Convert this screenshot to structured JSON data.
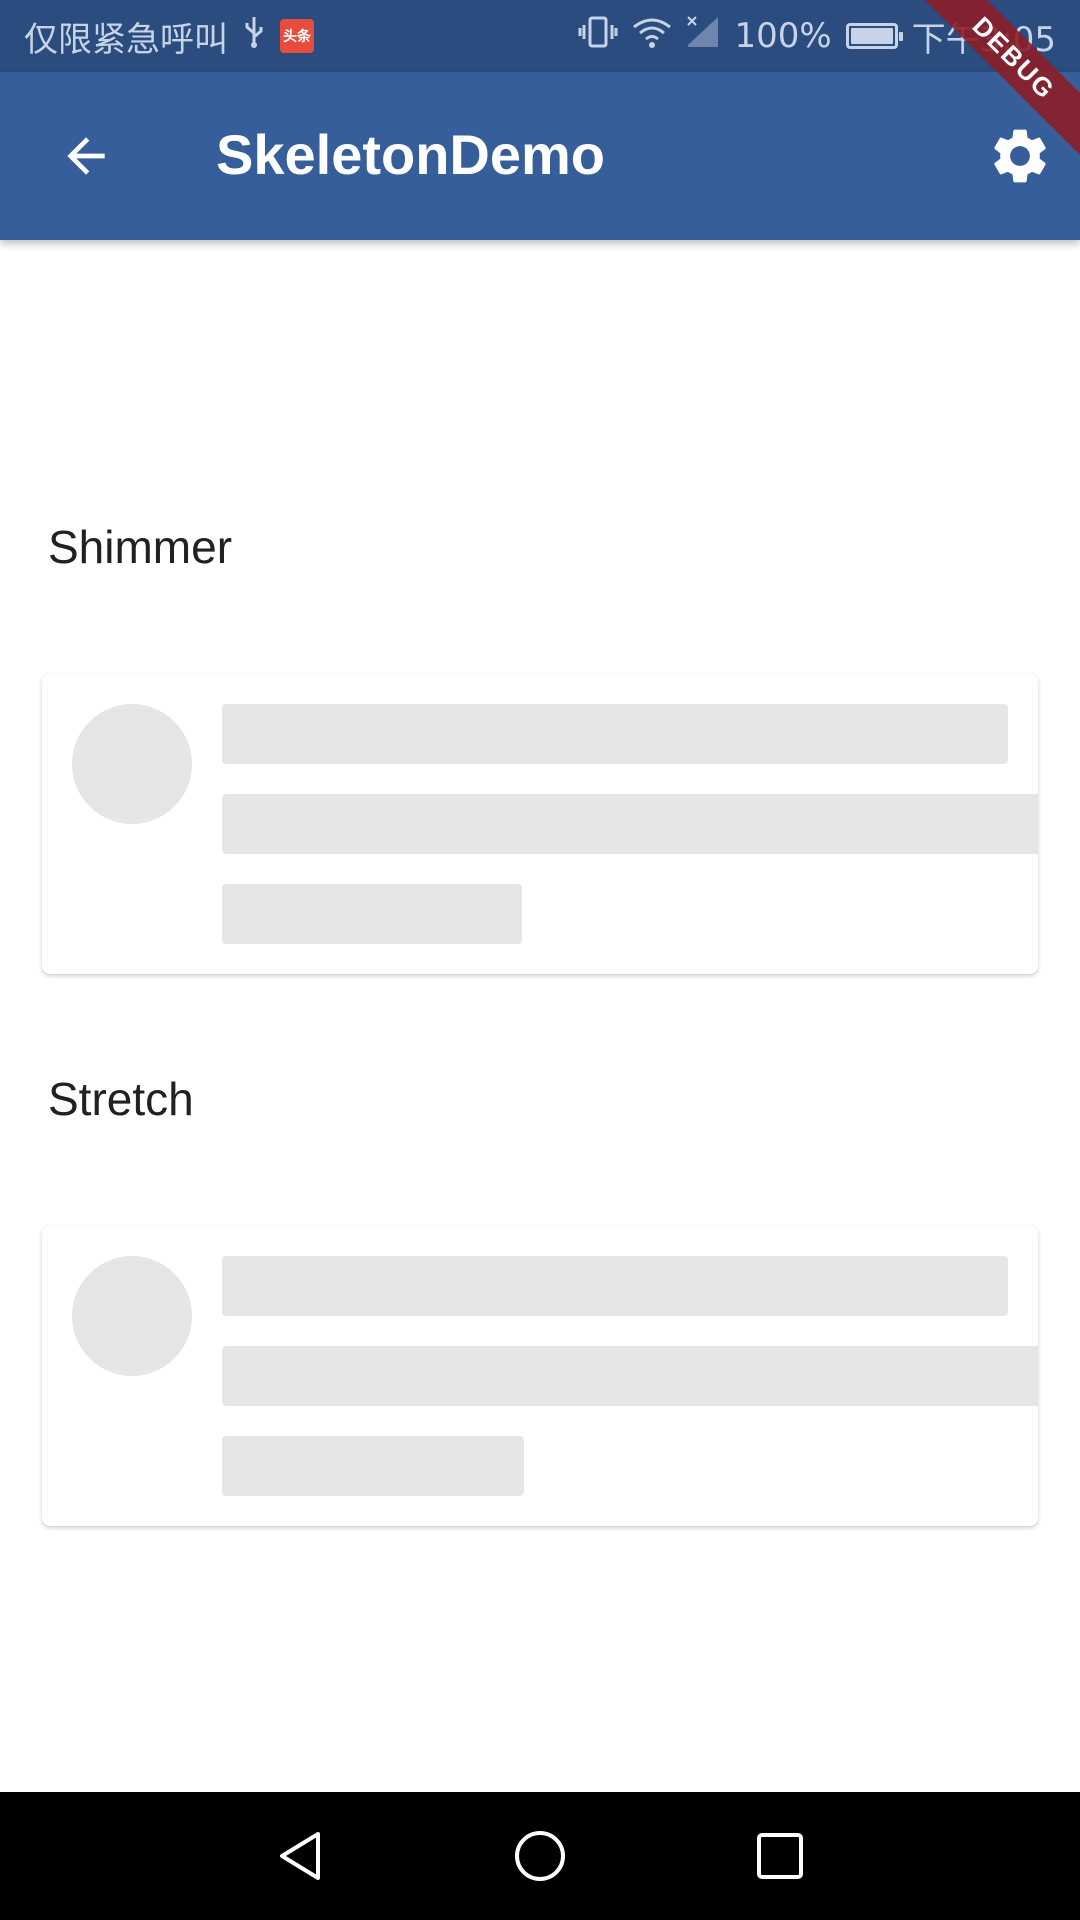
{
  "status_bar": {
    "carrier_text": "仅限紧急呼叫",
    "news_badge": "头条",
    "battery_percent": "100%",
    "time": "下午3:05",
    "icons": [
      "usb-icon",
      "news-app-icon",
      "vibrate-icon",
      "wifi-icon",
      "signal-icon",
      "battery-icon"
    ]
  },
  "app_bar": {
    "title": "SkeletonDemo",
    "back_icon": "arrow-back-icon",
    "settings_icon": "gear-icon",
    "background": "#365e9b"
  },
  "debug_banner": "DEBUG",
  "sections": [
    {
      "label": "Shimmer"
    },
    {
      "label": "Stretch"
    }
  ],
  "skeleton": {
    "placeholder_color": "#e6e6e6"
  },
  "nav_bar": {
    "icons": [
      "back-triangle-icon",
      "home-circle-icon",
      "recents-square-icon"
    ]
  }
}
